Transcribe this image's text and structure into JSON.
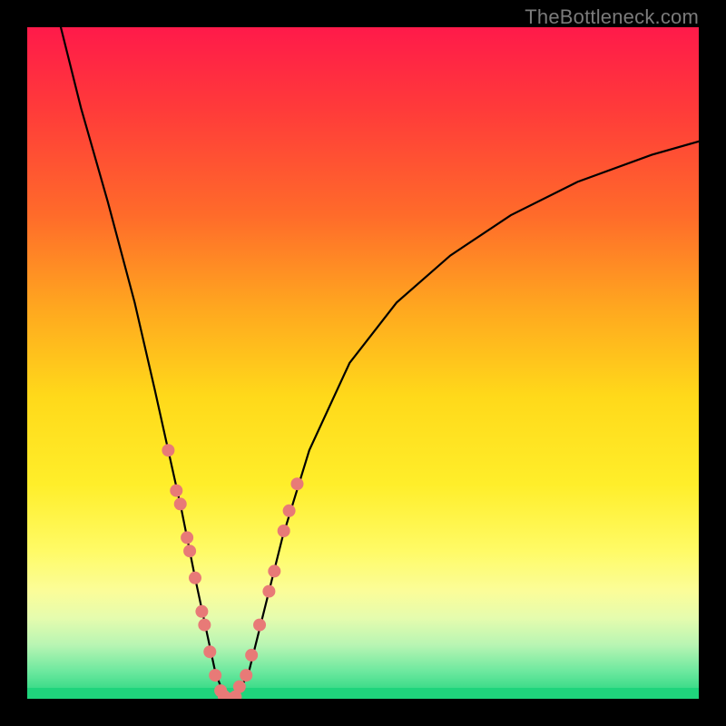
{
  "watermark": "TheBottleneck.com",
  "chart_data": {
    "type": "line",
    "title": "",
    "xlabel": "",
    "ylabel": "",
    "xlim": [
      0,
      100
    ],
    "ylim": [
      0,
      100
    ],
    "curve": {
      "x": [
        5,
        8,
        12,
        16,
        19,
        21,
        23,
        25,
        26.5,
        28,
        29.5,
        31,
        33,
        35,
        38,
        42,
        48,
        55,
        63,
        72,
        82,
        93,
        100
      ],
      "y": [
        100,
        88,
        74,
        59,
        46,
        37,
        28,
        18,
        11,
        4,
        0,
        0,
        4,
        12,
        24,
        37,
        50,
        59,
        66,
        72,
        77,
        81,
        83
      ]
    },
    "markers_left": {
      "x": [
        21.0,
        22.2,
        22.8,
        23.8,
        24.2,
        25.0,
        26.0,
        26.4,
        27.2,
        28.0,
        28.8,
        29.3
      ],
      "y": [
        37,
        31,
        29,
        24,
        22,
        18,
        13,
        11,
        7,
        3.5,
        1.2,
        0.4
      ]
    },
    "markers_right": {
      "x": [
        31.0,
        31.6,
        32.6,
        33.4,
        34.6,
        36.0,
        36.8,
        38.2,
        39.0,
        40.2
      ],
      "y": [
        0.3,
        1.8,
        3.5,
        6.5,
        11.0,
        16.0,
        19.0,
        25.0,
        28.0,
        32.0
      ]
    },
    "markers_bottom": {
      "x": [
        29.7,
        30.4
      ],
      "y": [
        0,
        0
      ]
    },
    "gradient_stops": [
      {
        "offset": 0,
        "color": "#ff1a4a"
      },
      {
        "offset": 12,
        "color": "#ff3a3a"
      },
      {
        "offset": 28,
        "color": "#ff6b2a"
      },
      {
        "offset": 42,
        "color": "#ffa81f"
      },
      {
        "offset": 55,
        "color": "#ffd91a"
      },
      {
        "offset": 68,
        "color": "#ffee2a"
      },
      {
        "offset": 78,
        "color": "#fffb66"
      },
      {
        "offset": 84,
        "color": "#fbfd99"
      },
      {
        "offset": 88,
        "color": "#e5fcae"
      },
      {
        "offset": 92,
        "color": "#b8f5b3"
      },
      {
        "offset": 96,
        "color": "#6be89e"
      },
      {
        "offset": 100,
        "color": "#1fd47c"
      }
    ]
  }
}
